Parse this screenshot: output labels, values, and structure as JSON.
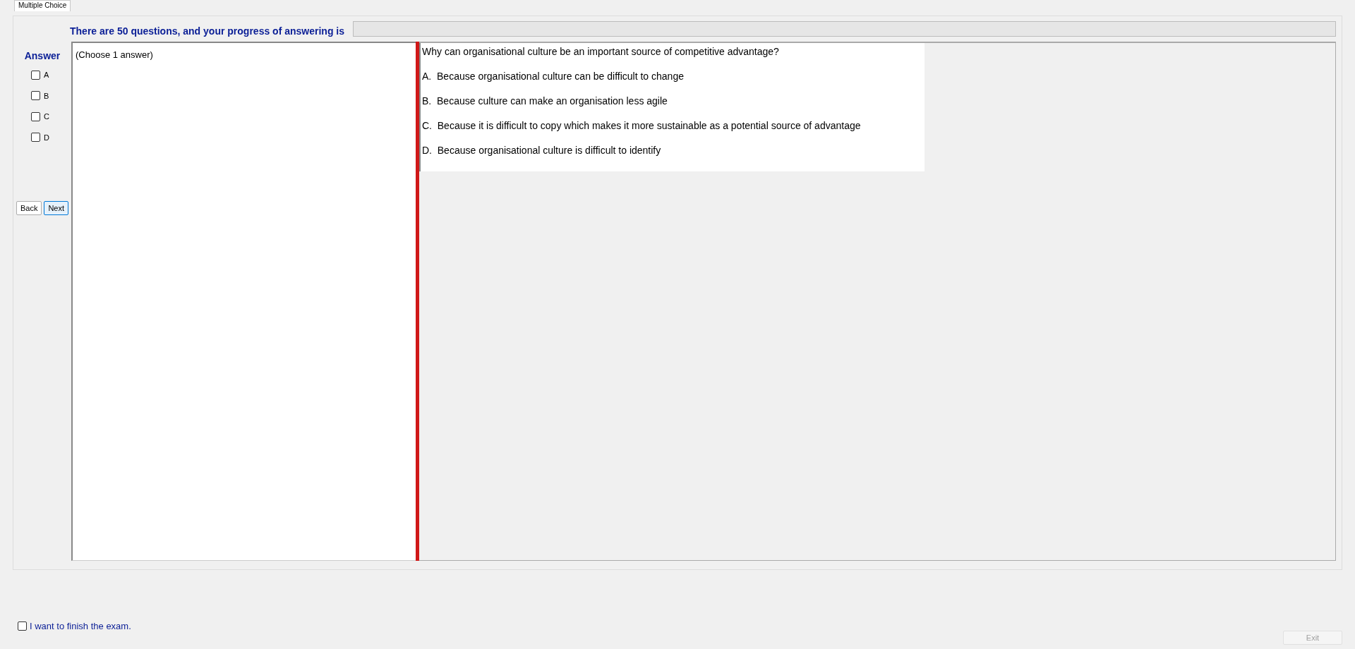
{
  "tabs": [
    {
      "label": "Multiple Choice",
      "selected": true
    }
  ],
  "progress": {
    "text": "There are 50 questions, and your progress of answering is",
    "level": 0
  },
  "answer": {
    "title": "Answer",
    "options": [
      {
        "label": "A",
        "checked": false
      },
      {
        "label": "B",
        "checked": false
      },
      {
        "label": "C",
        "checked": false
      },
      {
        "label": "D",
        "checked": false
      }
    ]
  },
  "buttons": {
    "back": "Back",
    "next": "Next"
  },
  "instruction": "(Choose 1 answer)",
  "question": {
    "text": "Why can organisational culture be an important source of competitive advantage?",
    "choices": [
      "A.  Because organisational culture can be difficult to change",
      "B.  Because culture can make an organisation less agile",
      "C.  Because it is difficult to copy which makes it more sustainable as a potential source of advantage",
      "D.  Because organisational culture is difficult to identify"
    ]
  },
  "finish": {
    "label": "I want to finish the exam.",
    "checked": false
  },
  "exit": {
    "label": "Exit",
    "disabled": true
  }
}
